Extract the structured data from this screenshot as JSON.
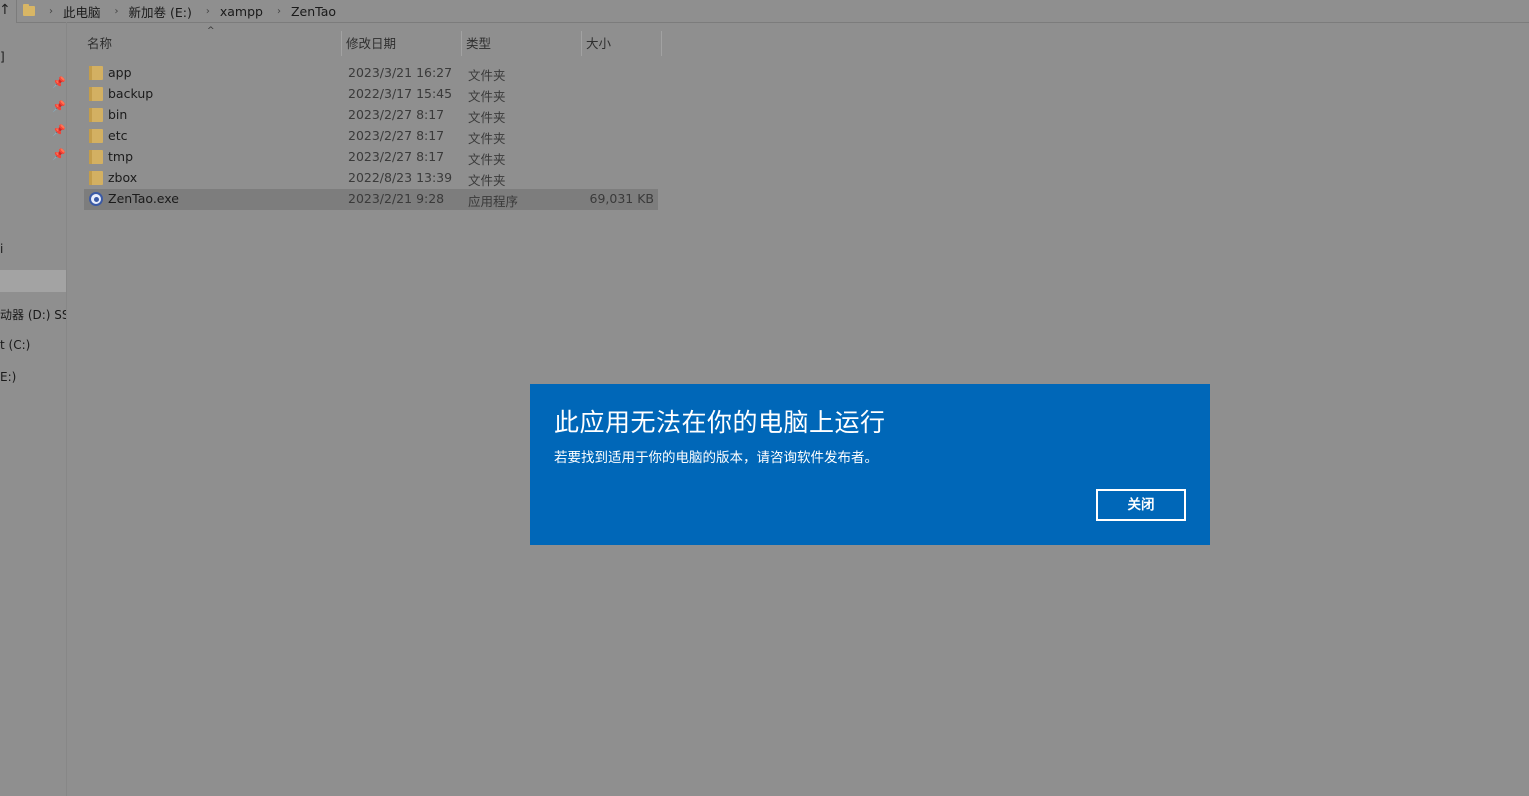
{
  "breadcrumb": {
    "items": [
      "此电脑",
      "新加卷 (E:)",
      "xampp",
      "ZenTao"
    ],
    "separator": "›"
  },
  "nav": {
    "items": [
      {
        "label": "]"
      },
      {
        "label": "i"
      },
      {
        "label": "动器 (D:) SSS"
      },
      {
        "label": "t (C:)"
      },
      {
        "label": "E:)"
      }
    ]
  },
  "columns": {
    "name": "名称",
    "date": "修改日期",
    "type": "类型",
    "size": "大小"
  },
  "files": [
    {
      "name": "app",
      "date": "2023/3/21 16:27",
      "type": "文件夹",
      "size": "",
      "icon": "folder-icon"
    },
    {
      "name": "backup",
      "date": "2022/3/17 15:45",
      "type": "文件夹",
      "size": "",
      "icon": "folder-icon"
    },
    {
      "name": "bin",
      "date": "2023/2/27 8:17",
      "type": "文件夹",
      "size": "",
      "icon": "folder-icon"
    },
    {
      "name": "etc",
      "date": "2023/2/27 8:17",
      "type": "文件夹",
      "size": "",
      "icon": "folder-icon"
    },
    {
      "name": "tmp",
      "date": "2023/2/27 8:17",
      "type": "文件夹",
      "size": "",
      "icon": "folder-icon"
    },
    {
      "name": "zbox",
      "date": "2022/8/23 13:39",
      "type": "文件夹",
      "size": "",
      "icon": "folder-icon"
    },
    {
      "name": "ZenTao.exe",
      "date": "2023/2/21 9:28",
      "type": "应用程序",
      "size": "69,031 KB",
      "icon": "application-icon"
    }
  ],
  "dialog": {
    "title": "此应用无法在你的电脑上运行",
    "message": "若要找到适用于你的电脑的版本，请咨询软件发布者。",
    "close_label": "关闭",
    "color": "#0067b8"
  }
}
